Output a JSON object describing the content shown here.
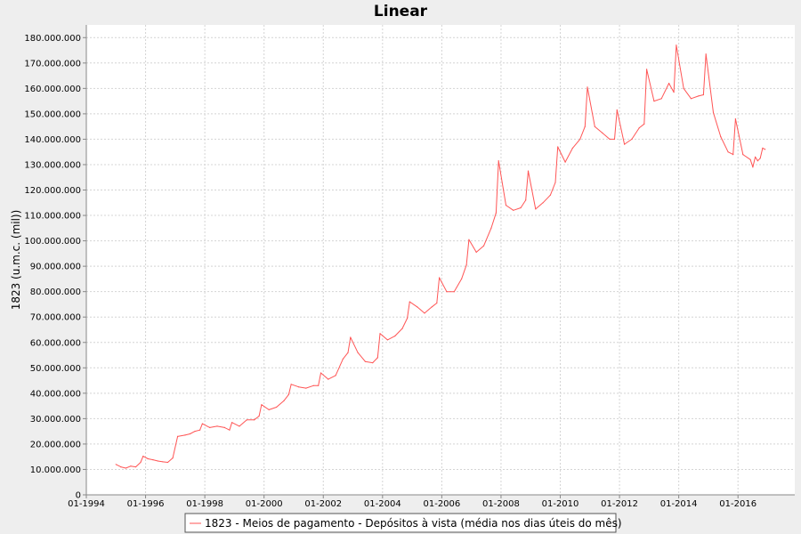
{
  "chart_data": {
    "type": "line",
    "title": "Linear",
    "xlabel": "",
    "ylabel": "1823 (u.m.c. (mil))",
    "xlim": [
      "01-1994",
      "12-2017"
    ],
    "ylim": [
      0,
      185000000
    ],
    "grid": true,
    "legend_position": "bottom",
    "x_tick_labels": [
      "01-1994",
      "01-1996",
      "01-1998",
      "01-2000",
      "01-2002",
      "01-2004",
      "01-2006",
      "01-2008",
      "01-2010",
      "01-2012",
      "01-2014",
      "01-2016"
    ],
    "y_tick_labels": [
      "0",
      "10.000.000",
      "20.000.000",
      "30.000.000",
      "40.000.000",
      "50.000.000",
      "60.000.000",
      "70.000.000",
      "80.000.000",
      "90.000.000",
      "100.000.000",
      "110.000.000",
      "120.000.000",
      "130.000.000",
      "140.000.000",
      "150.000.000",
      "160.000.000",
      "170.000.000",
      "180.000.000"
    ],
    "series": [
      {
        "name": "1823 - Meios de pagamento - Depósitos à vista (média nos dias úteis do mês)",
        "color": "#ff5555",
        "points": [
          [
            "01-1995",
            12000000
          ],
          [
            "03-1995",
            11000000
          ],
          [
            "05-1995",
            10500000
          ],
          [
            "07-1995",
            11300000
          ],
          [
            "09-1995",
            11000000
          ],
          [
            "11-1995",
            12800000
          ],
          [
            "12-1995",
            15200000
          ],
          [
            "02-1996",
            14200000
          ],
          [
            "04-1996",
            13800000
          ],
          [
            "06-1996",
            13300000
          ],
          [
            "08-1996",
            13000000
          ],
          [
            "10-1996",
            12800000
          ],
          [
            "12-1996",
            14500000
          ],
          [
            "02-1997",
            23000000
          ],
          [
            "05-1997",
            23500000
          ],
          [
            "07-1997",
            24000000
          ],
          [
            "09-1997",
            25000000
          ],
          [
            "11-1997",
            25500000
          ],
          [
            "12-1997",
            28000000
          ],
          [
            "03-1998",
            26500000
          ],
          [
            "06-1998",
            27000000
          ],
          [
            "09-1998",
            26500000
          ],
          [
            "11-1998",
            25500000
          ],
          [
            "12-1998",
            28500000
          ],
          [
            "03-1999",
            27000000
          ],
          [
            "06-1999",
            29500000
          ],
          [
            "09-1999",
            29500000
          ],
          [
            "11-1999",
            31000000
          ],
          [
            "12-1999",
            35500000
          ],
          [
            "03-2000",
            33500000
          ],
          [
            "06-2000",
            34500000
          ],
          [
            "09-2000",
            37000000
          ],
          [
            "11-2000",
            39500000
          ],
          [
            "12-2000",
            43500000
          ],
          [
            "03-2001",
            42500000
          ],
          [
            "06-2001",
            42000000
          ],
          [
            "09-2001",
            43000000
          ],
          [
            "11-2001",
            43000000
          ],
          [
            "12-2001",
            48000000
          ],
          [
            "03-2002",
            45500000
          ],
          [
            "06-2002",
            47000000
          ],
          [
            "09-2002",
            53500000
          ],
          [
            "11-2002",
            56000000
          ],
          [
            "12-2002",
            62000000
          ],
          [
            "03-2003",
            56000000
          ],
          [
            "06-2003",
            52500000
          ],
          [
            "09-2003",
            52000000
          ],
          [
            "11-2003",
            54000000
          ],
          [
            "12-2003",
            63500000
          ],
          [
            "03-2004",
            61000000
          ],
          [
            "06-2004",
            62500000
          ],
          [
            "09-2004",
            65500000
          ],
          [
            "11-2004",
            69500000
          ],
          [
            "12-2004",
            76000000
          ],
          [
            "03-2005",
            74000000
          ],
          [
            "06-2005",
            71500000
          ],
          [
            "09-2005",
            74000000
          ],
          [
            "11-2005",
            75500000
          ],
          [
            "12-2005",
            85500000
          ],
          [
            "03-2006",
            80000000
          ],
          [
            "06-2006",
            80000000
          ],
          [
            "09-2006",
            85000000
          ],
          [
            "11-2006",
            90500000
          ],
          [
            "12-2006",
            100500000
          ],
          [
            "03-2007",
            95500000
          ],
          [
            "06-2007",
            98000000
          ],
          [
            "09-2007",
            105000000
          ],
          [
            "11-2007",
            111000000
          ],
          [
            "12-2007",
            131500000
          ],
          [
            "03-2008",
            114000000
          ],
          [
            "06-2008",
            112000000
          ],
          [
            "09-2008",
            113000000
          ],
          [
            "11-2008",
            116000000
          ],
          [
            "12-2008",
            127500000
          ],
          [
            "03-2009",
            112500000
          ],
          [
            "06-2009",
            115000000
          ],
          [
            "09-2009",
            118000000
          ],
          [
            "11-2009",
            123000000
          ],
          [
            "12-2009",
            137000000
          ],
          [
            "03-2010",
            131000000
          ],
          [
            "06-2010",
            136500000
          ],
          [
            "09-2010",
            140000000
          ],
          [
            "11-2010",
            145000000
          ],
          [
            "12-2010",
            160500000
          ],
          [
            "03-2011",
            145000000
          ],
          [
            "06-2011",
            142500000
          ],
          [
            "09-2011",
            140000000
          ],
          [
            "11-2011",
            140000000
          ],
          [
            "12-2011",
            151500000
          ],
          [
            "03-2012",
            138000000
          ],
          [
            "06-2012",
            140000000
          ],
          [
            "09-2012",
            144500000
          ],
          [
            "11-2012",
            146000000
          ],
          [
            "12-2012",
            167500000
          ],
          [
            "03-2013",
            155000000
          ],
          [
            "06-2013",
            156000000
          ],
          [
            "09-2013",
            162000000
          ],
          [
            "11-2013",
            158500000
          ],
          [
            "12-2013",
            177000000
          ],
          [
            "03-2014",
            160000000
          ],
          [
            "06-2014",
            156000000
          ],
          [
            "09-2014",
            157000000
          ],
          [
            "11-2014",
            157500000
          ],
          [
            "12-2014",
            173500000
          ],
          [
            "03-2015",
            150500000
          ],
          [
            "06-2015",
            141000000
          ],
          [
            "09-2015",
            135000000
          ],
          [
            "11-2015",
            134000000
          ],
          [
            "12-2015",
            148000000
          ],
          [
            "03-2016",
            134000000
          ],
          [
            "06-2016",
            132000000
          ],
          [
            "07-2016",
            129000000
          ],
          [
            "08-2016",
            133000000
          ],
          [
            "09-2016",
            131500000
          ],
          [
            "10-2016",
            132500000
          ],
          [
            "11-2016",
            136500000
          ],
          [
            "12-2016",
            136000000
          ]
        ]
      }
    ]
  }
}
